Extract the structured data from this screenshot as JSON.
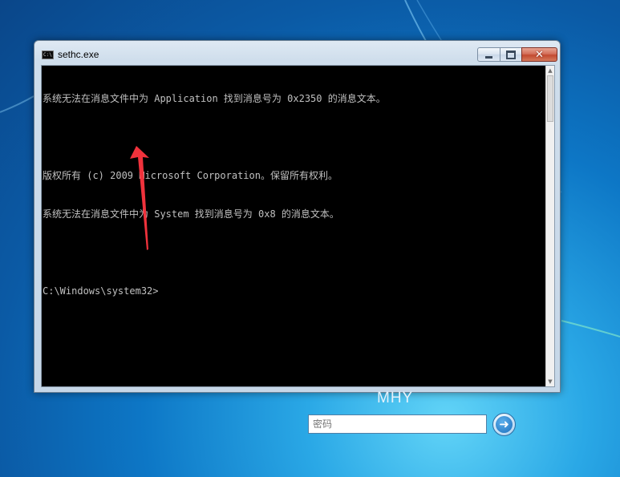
{
  "window": {
    "title": "sethc.exe",
    "icon_glyph": "C:\\",
    "controls": {
      "minimize_icon": "minimize-icon",
      "maximize_icon": "maximize-icon",
      "close_icon": "close-icon",
      "close_glyph": "✕"
    }
  },
  "console": {
    "lines": [
      "系统无法在消息文件中为 Application 找到消息号为 0x2350 的消息文本。",
      "",
      "版权所有 (c) 2009 Microsoft Corporation。保留所有权利。",
      "系统无法在消息文件中为 System 找到消息号为 0x8 的消息文本。",
      "",
      "C:\\Windows\\system32>"
    ]
  },
  "annotation": {
    "color": "#f0323c"
  },
  "logon": {
    "user_name": "MHY",
    "password_placeholder": "密码",
    "go_glyph": "➜"
  },
  "colors": {
    "desktop": "#0b6fc4",
    "console_bg": "#000000",
    "console_text": "#c0c0c0"
  }
}
